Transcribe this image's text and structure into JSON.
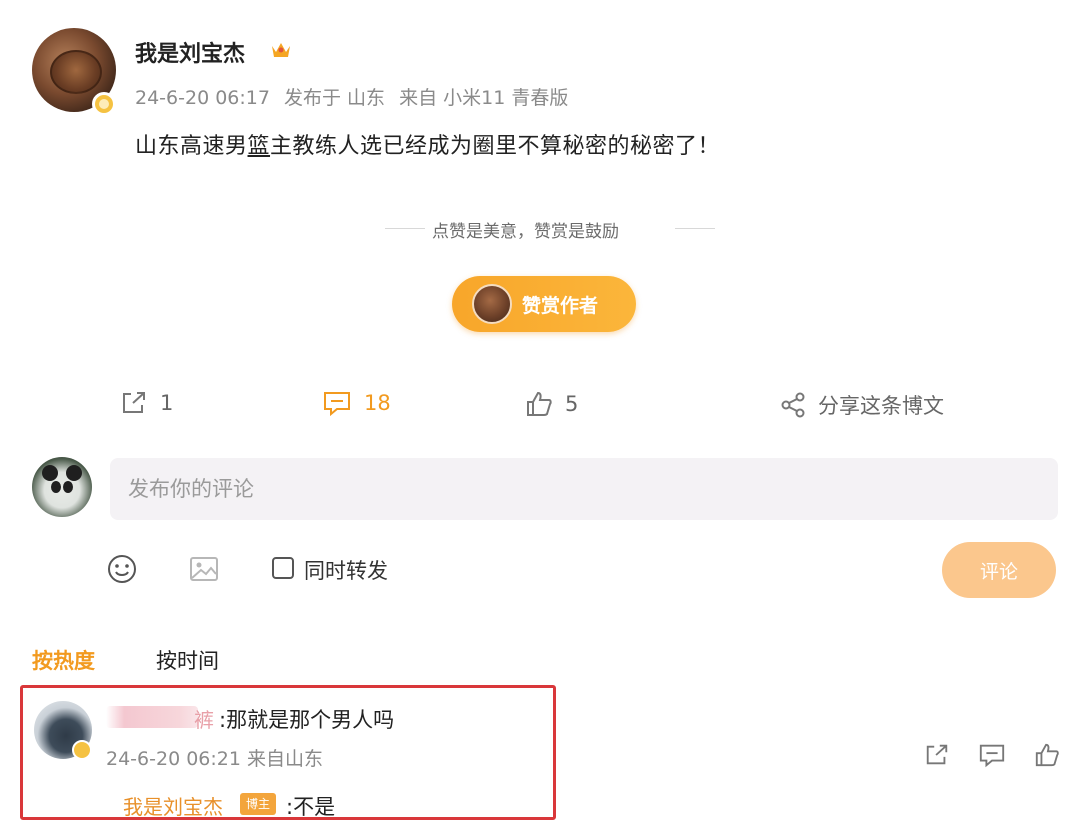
{
  "post": {
    "author": "我是刘宝杰",
    "date": "24-6-20 06:17",
    "published": "发布于 山东",
    "source": "来自 小米11 青春版",
    "text_before": "山东高速男",
    "text_underlined": "篮",
    "text_after": "主教练人选已经成为圈里不算秘密的秘密了！"
  },
  "reward": {
    "slogan": "点赞是美意，赞赏是鼓励",
    "button": "赞赏作者"
  },
  "actions": {
    "repost_count": "1",
    "comment_count": "18",
    "like_count": "5",
    "share_label": "分享这条博文"
  },
  "composer": {
    "placeholder": "发布你的评论",
    "sync_label": "同时转发",
    "submit": "评论"
  },
  "sort_tabs": {
    "hot": "按热度",
    "time": "按时间"
  },
  "comment": {
    "name_tail": "裤",
    "text": ":那就是那个男人吗",
    "meta": "24-6-20 06:21 来自山东",
    "reply_name": "我是刘宝杰",
    "reply_badge": "博主",
    "reply_text": ":不是"
  },
  "colors": {
    "accent": "#f29a1f",
    "highlight_frame": "#d9373a"
  }
}
